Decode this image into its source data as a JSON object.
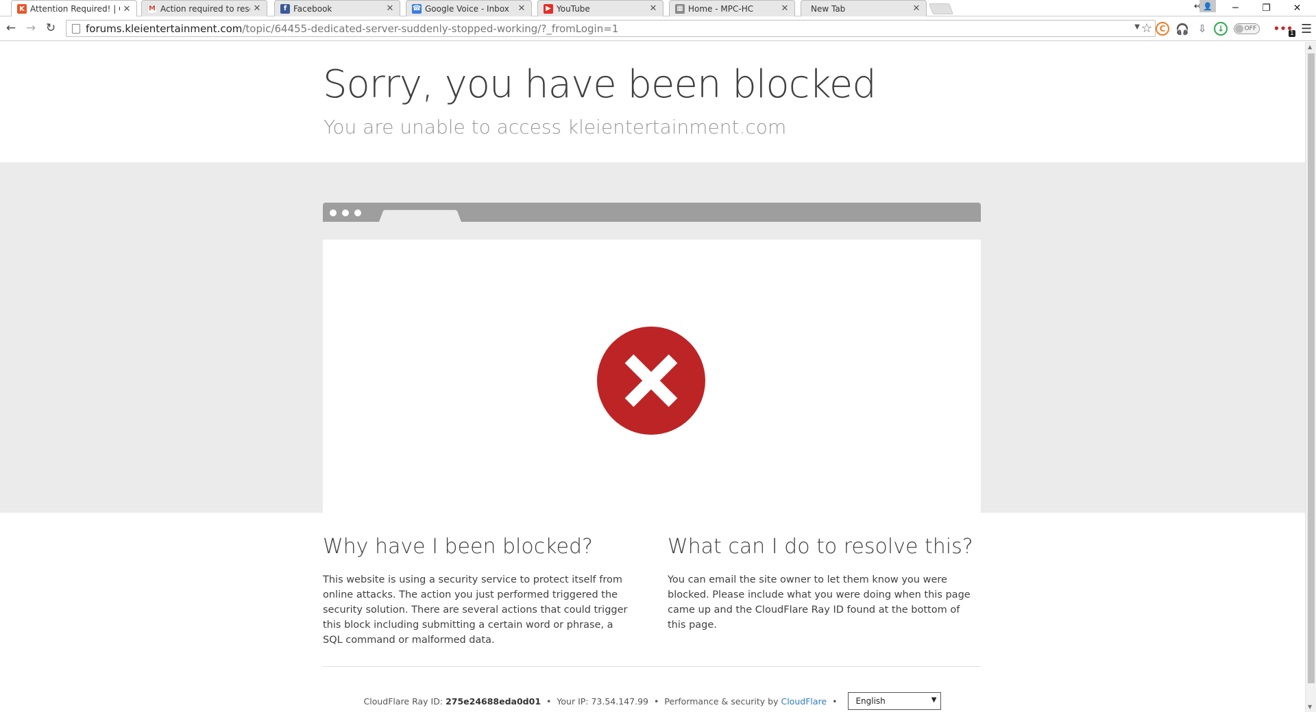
{
  "tabs": [
    {
      "title": "Attention Required! | Cloudflare",
      "icon": "kleientertainment-k-icon",
      "active": true
    },
    {
      "title": "Action required to reset your password",
      "icon": "gmail-icon"
    },
    {
      "title": "Facebook",
      "icon": "facebook-icon"
    },
    {
      "title": "Google Voice - Inbox",
      "icon": "google-voice-icon"
    },
    {
      "title": "YouTube",
      "icon": "youtube-icon"
    },
    {
      "title": "Home - MPC-HC",
      "icon": "mpc-hc-icon"
    },
    {
      "title": "New Tab",
      "icon": "none"
    }
  ],
  "address_bar": {
    "domain": "forums.kleientertainment.com",
    "path": "/topic/64455-dedicated-server-suddenly-stopped-working/?_fromLogin=1"
  },
  "extensions": {
    "toggle_label": "OFF",
    "badge_count": "1"
  },
  "page": {
    "title": "Sorry, you have been blocked",
    "subtitle": "You are unable to access kleientertainment.com",
    "why_heading": "Why have I been blocked?",
    "why_text": "This website is using a security service to protect itself from online attacks. The action you just performed triggered the security solution. There are several actions that could trigger this block including submitting a certain word or phrase, a SQL command or malformed data.",
    "resolve_heading": "What can I do to resolve this?",
    "resolve_text": "You can email the site owner to let them know you were blocked. Please include what you were doing when this page came up and the CloudFlare Ray ID found at the bottom of this page."
  },
  "footer": {
    "ray_label": "CloudFlare Ray ID:",
    "ray_id": "275e24688eda0d01",
    "ip_label": "Your IP: 73.54.147.99",
    "perf_label": "Performance & security by",
    "cloudflare_link": "CloudFlare",
    "separator": "•",
    "language": "English"
  },
  "colors": {
    "block_red": "#bd2426",
    "link_blue": "#2f7bbf",
    "band_gray": "#ebebeb"
  }
}
